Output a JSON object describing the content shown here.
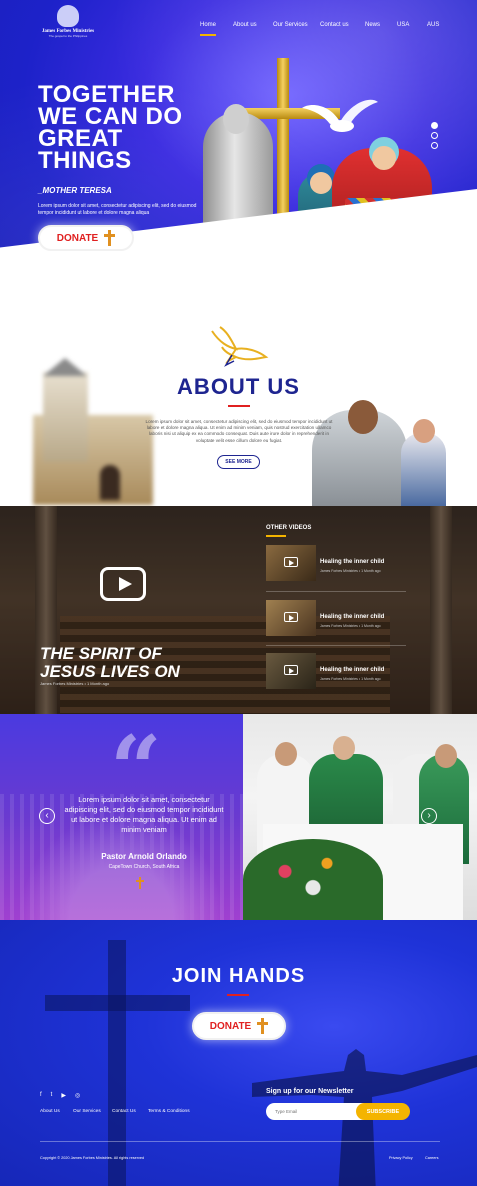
{
  "logo": {
    "name": "James Forbes Ministries",
    "tagline": "The gospel to the Philippines"
  },
  "nav": {
    "items": [
      {
        "label": "Home",
        "active": true
      },
      {
        "label": "About us"
      },
      {
        "label": "Our Services"
      },
      {
        "label": "Contact us"
      },
      {
        "label": "News"
      },
      {
        "label": "USA"
      },
      {
        "label": "AUS"
      }
    ]
  },
  "hero": {
    "title_lines": [
      "TOGETHER",
      "WE CAN DO",
      "GREAT",
      "THINGS"
    ],
    "author": "_MOTHER TERESA",
    "text": "Lorem ipsum dolor sit amet, consectetur adipiscing elit, sed do eiusmod tempor incididunt ut labore et dolore magna aliqua",
    "donate_label": "DONATE",
    "slides": 3,
    "active_slide": 1
  },
  "about": {
    "title": "ABOUT US",
    "text": "Lorem ipsum dolor sit amet, consectetur adipiscing elit, sed do eiusmod tempor incididunt ut labore et dolore magna aliqua. Ut enim ad minim veniam, quis nostrud exercitation ullamco laboris nisi ut aliquip ex ea commodo consequat. Duis aute irure dolor in reprehenderit in voluptate velit esse cillum dolore eu fugiat.",
    "button": "SEE MORE"
  },
  "video": {
    "title_line1": "THE SPIRIT OF",
    "title_line2": "JESUS LIVES ON",
    "meta": "James Forbes Ministries  •  1 Month ago",
    "other_heading": "OTHER VIDEOS",
    "others": [
      {
        "title": "Healing the inner child",
        "meta": "James Forbes Ministries  •  1 Month ago"
      },
      {
        "title": "Healing the inner child",
        "meta": "James Forbes Ministries  •  1 Month ago"
      },
      {
        "title": "Healing the inner child",
        "meta": "James Forbes Ministries  •  1 Month ago"
      }
    ]
  },
  "testimonial": {
    "quote": "Lorem ipsum dolor sit amet, consectetur adipiscing elit, sed do eiusmod tempor incididunt ut labore et dolore magna aliqua. Ut enim ad minim veniam",
    "name": "Pastor Arnold Orlando",
    "place": "CapeTown Church, South Africa",
    "prev": "‹",
    "next": "›"
  },
  "join": {
    "title": "JOIN HANDS",
    "donate_label": "DONATE"
  },
  "footer": {
    "social": [
      "f",
      "t",
      "▶",
      "◎"
    ],
    "links": [
      "About Us",
      "Our Services",
      "Contact Us",
      "Terms & Conditions"
    ],
    "newsletter_title": "Sign up for our Newsletter",
    "newsletter_placeholder": "Type Email",
    "subscribe": "SUBSCRIBE",
    "copyright": "Copyright © 2020 James Forbes Ministries. All rights reserved",
    "privacy": "Privacy Policy",
    "careers": "Careers"
  },
  "colors": {
    "brand_blue": "#1e2590",
    "accent_red": "#e02020",
    "accent_gold": "#f4b400"
  }
}
